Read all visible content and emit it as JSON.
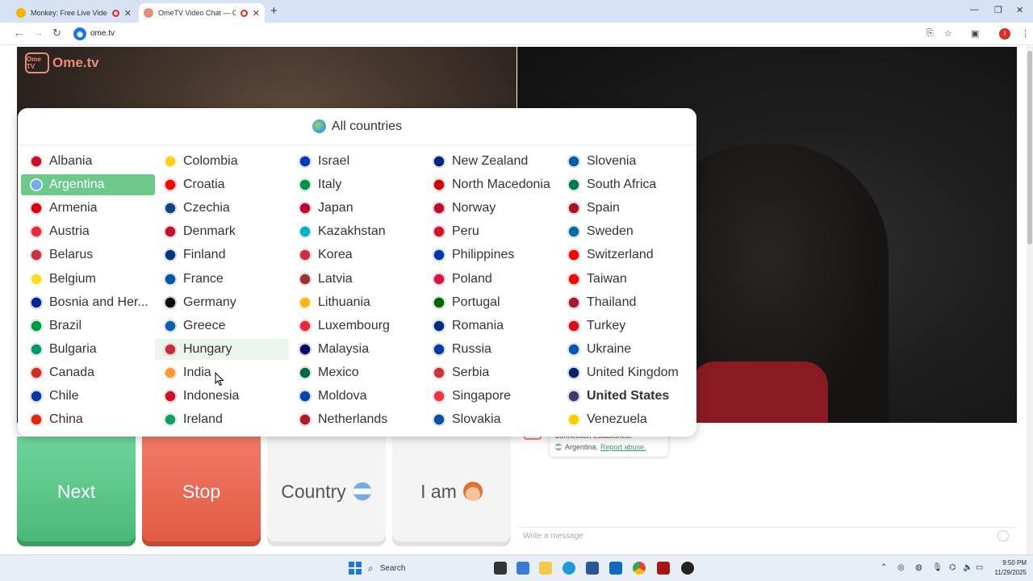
{
  "browser": {
    "tabs": [
      {
        "title": "Monkey: Free Live Video Ch",
        "active": false
      },
      {
        "title": "OmeTV Video Chat — Ome",
        "active": true
      }
    ],
    "url": "ome.tv",
    "profile_initial": "I"
  },
  "site": {
    "logo_badge": "Ome TV",
    "logo_text": "Ome.tv"
  },
  "country_dropdown": {
    "title": "All countries",
    "selected": "Argentina",
    "hovered": "Hungary",
    "bold": "United States",
    "columns": [
      [
        "Albania",
        "Argentina",
        "Armenia",
        "Austria",
        "Belarus",
        "Belgium",
        "Bosnia and Her...",
        "Brazil",
        "Bulgaria",
        "Canada",
        "Chile",
        "China"
      ],
      [
        "Colombia",
        "Croatia",
        "Czechia",
        "Denmark",
        "Finland",
        "France",
        "Germany",
        "Greece",
        "Hungary",
        "India",
        "Indonesia",
        "Ireland"
      ],
      [
        "Israel",
        "Italy",
        "Japan",
        "Kazakhstan",
        "Korea",
        "Latvia",
        "Lithuania",
        "Luxembourg",
        "Malaysia",
        "Mexico",
        "Moldova",
        "Netherlands"
      ],
      [
        "New Zealand",
        "North Macedonia",
        "Norway",
        "Peru",
        "Philippines",
        "Poland",
        "Portugal",
        "Romania",
        "Russia",
        "Serbia",
        "Singapore",
        "Slovakia"
      ],
      [
        "Slovenia",
        "South Africa",
        "Spain",
        "Sweden",
        "Switzerland",
        "Taiwan",
        "Thailand",
        "Turkey",
        "Ukraine",
        "United Kingdom",
        "United States",
        "Venezuela"
      ]
    ],
    "flag_colors": [
      [
        "#c8102e",
        "#74acdf",
        "#d90012",
        "#ed2939",
        "#c8313e",
        "#fdda24",
        "#002395",
        "#009c3b",
        "#00966e",
        "#d52b1e",
        "#0039a6",
        "#de2910"
      ],
      [
        "#fcd116",
        "#ff0000",
        "#11457e",
        "#c60c30",
        "#003580",
        "#0055a4",
        "#000000",
        "#0d5eaf",
        "#cd2a3e",
        "#ff9933",
        "#ce1126",
        "#169b62"
      ],
      [
        "#0038b8",
        "#009246",
        "#bc002d",
        "#00afca",
        "#cd2e3a",
        "#9e3039",
        "#fdb913",
        "#ed2939",
        "#010066",
        "#006847",
        "#0046ae",
        "#ae1c28"
      ],
      [
        "#00247d",
        "#d20000",
        "#ba0c2f",
        "#d91023",
        "#0038a8",
        "#dc143c",
        "#006600",
        "#002b7f",
        "#0039a6",
        "#c6363c",
        "#ef3340",
        "#0b4ea2"
      ],
      [
        "#005da4",
        "#007a4d",
        "#aa151b",
        "#006aa7",
        "#ff0000",
        "#fe0000",
        "#a51931",
        "#e30a17",
        "#0057b7",
        "#012169",
        "#3c3b6e",
        "#ffcc00"
      ]
    ]
  },
  "buttons": {
    "next": "Next",
    "stop": "Stop",
    "country": "Country",
    "iam": "I am"
  },
  "chat": {
    "message_line1": "Connection established.",
    "message_country": "Argentina.",
    "report_link": "Report abuse.",
    "input_placeholder": "Write a message"
  },
  "taskbar": {
    "search_label": "Search",
    "time": "9:50 PM",
    "date": "11/29/2025"
  }
}
